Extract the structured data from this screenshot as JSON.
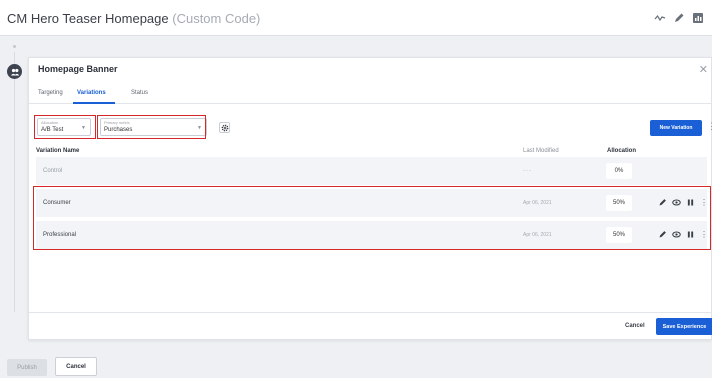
{
  "header": {
    "title": "CM Hero Teaser Homepage",
    "subtitle": "(Custom Code)",
    "icons": [
      "activity-icon",
      "pencil-icon",
      "report-icon"
    ]
  },
  "modal": {
    "title": "Homepage Banner",
    "tabs": [
      {
        "label": "Targeting"
      },
      {
        "label": "Variations",
        "active": true
      },
      {
        "label": "Status"
      }
    ],
    "allocation": {
      "label": "Allocation",
      "value": "A/B Test"
    },
    "primary_metric": {
      "label": "Primary metric",
      "value": "Purchases"
    },
    "new_variation_label": "New Variation",
    "columns": {
      "name": "Variation Name",
      "modified": "Last Modified",
      "allocation": "Allocation"
    },
    "rows": [
      {
        "name": "Control",
        "modified": "- - -",
        "allocation": "0%"
      },
      {
        "name": "Consumer",
        "modified": "Apr 06, 2021",
        "allocation": "50%"
      },
      {
        "name": "Professional",
        "modified": "Apr 06, 2021",
        "allocation": "50%"
      }
    ],
    "footer": {
      "cancel_label": "Cancel",
      "save_label": "Save Experience"
    }
  },
  "page_footer": {
    "publish_label": "Publish",
    "cancel_label": "Cancel"
  },
  "colors": {
    "accent": "#1a5fd6",
    "highlight": "#d62828",
    "row_background": "#f2f4f7"
  }
}
